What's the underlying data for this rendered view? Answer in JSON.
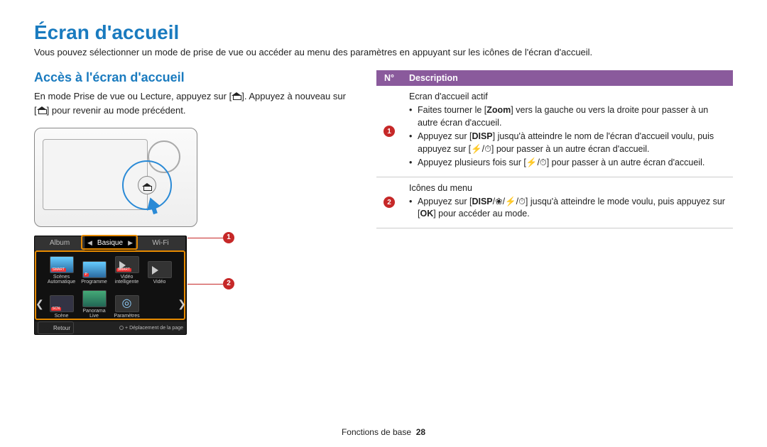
{
  "title": "Écran d'accueil",
  "intro": "Vous pouvez sélectionner un mode de prise de vue ou accéder au menu des paramètres en appuyant sur les icônes de l'écran d'accueil.",
  "subheading": "Accès à l'écran d'accueil",
  "access_pre": "En mode Prise de vue ou Lecture, appuyez sur [",
  "access_mid": "]. Appuyez à nouveau sur [",
  "access_post": "] pour revenir au mode précédent.",
  "screenshot": {
    "tabs": {
      "album": "Album",
      "basique": "Basique",
      "wifi": "Wi-Fi"
    },
    "grid": [
      {
        "label": "Scènes Automatique",
        "badge": "SMART",
        "cls": ""
      },
      {
        "label": "Programme",
        "badge": "P",
        "cls": ""
      },
      {
        "label": "Vidéo intelligente",
        "badge": "SMART",
        "cls": "vid"
      },
      {
        "label": "Vidéo",
        "badge": "",
        "cls": "vid"
      },
      {
        "label": "Scène",
        "badge": "SCN",
        "cls": "scn"
      },
      {
        "label": "Panorama Live",
        "badge": "",
        "cls": "pano"
      },
      {
        "label": "Paramètres",
        "badge": "",
        "cls": "param"
      }
    ],
    "retour": "Retour",
    "deplacement": "Déplacement de la page"
  },
  "table": {
    "head_n": "N°",
    "head_desc": "Description",
    "row1": {
      "n": "1",
      "title": "Ecran d'accueil actif",
      "b1_pre": "Faites tourner le [",
      "b1_zoom": "Zoom",
      "b1_post": "] vers la gauche ou vers la droite pour passer à un autre écran d'accueil.",
      "b2_a": "Appuyez sur [",
      "b2_disp": "DISP",
      "b2_b": "] jusqu'à atteindre le nom de l'écran d'accueil voulu, puis appuyez sur [",
      "b2_c": "] pour passer à un autre écran d'accueil.",
      "b3_a": "Appuyez plusieurs fois sur [",
      "b3_b": "] pour passer à un autre écran d'accueil."
    },
    "row2": {
      "n": "2",
      "title": "Icônes du menu",
      "b1_a": "Appuyez sur [",
      "b1_disp": "DISP",
      "b1_b": "] jusqu'à atteindre le mode voulu, puis appuyez sur [",
      "b1_ok": "OK",
      "b1_c": "] pour accéder au mode."
    }
  },
  "footer_label": "Fonctions de base",
  "footer_page": "28"
}
